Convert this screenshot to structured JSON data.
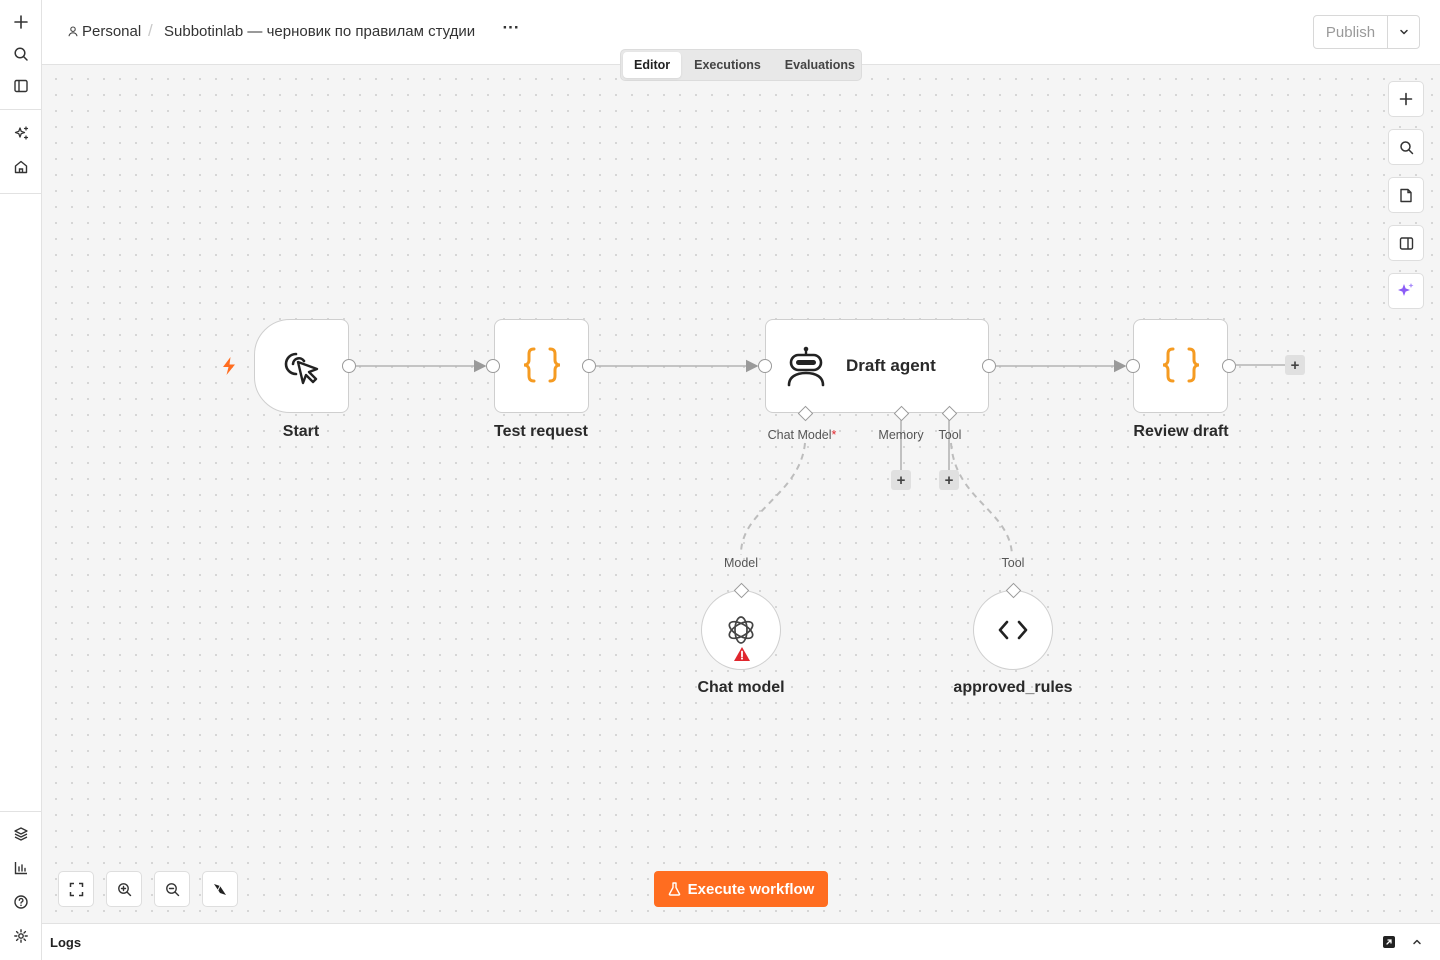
{
  "sidebar": {
    "top_icons": [
      "plus-icon",
      "search-icon",
      "panel-icon",
      "sparkles-icon",
      "home-icon"
    ],
    "bottom_icons": [
      "layers-icon",
      "bar-chart-icon",
      "help-icon",
      "gear-icon"
    ]
  },
  "header": {
    "project": "Personal",
    "workflow_name": "Subbotinlab — черновик по правилам студии",
    "more_label": "···",
    "publish_label": "Publish"
  },
  "tabs": [
    {
      "label": "Editor",
      "active": true
    },
    {
      "label": "Executions",
      "active": false
    },
    {
      "label": "Evaluations",
      "active": false
    }
  ],
  "nodes": {
    "start": {
      "label": "Start",
      "icon": "cursor-click-icon"
    },
    "test_request": {
      "label": "Test request",
      "icon": "braces-icon"
    },
    "draft_agent": {
      "label": "Draft agent",
      "icon": "robot-icon"
    },
    "review_draft": {
      "label": "Review draft",
      "icon": "braces-icon"
    },
    "chat_model": {
      "label": "Chat model",
      "icon": "openai-icon",
      "warning": true
    },
    "approved_rules": {
      "label": "approved_rules",
      "icon": "code-icon"
    }
  },
  "ports": {
    "chat_model": "Chat Model",
    "chat_model_required": "*",
    "memory": "Memory",
    "tool": "Tool",
    "model_in": "Model",
    "tool_in": "Tool"
  },
  "execute_label": "Execute workflow",
  "logs_label": "Logs",
  "colors": {
    "accent": "#ff6d20",
    "braces": "#f59b22",
    "ai_purple": "#8b5cf6",
    "warning_red": "#e0262d"
  }
}
